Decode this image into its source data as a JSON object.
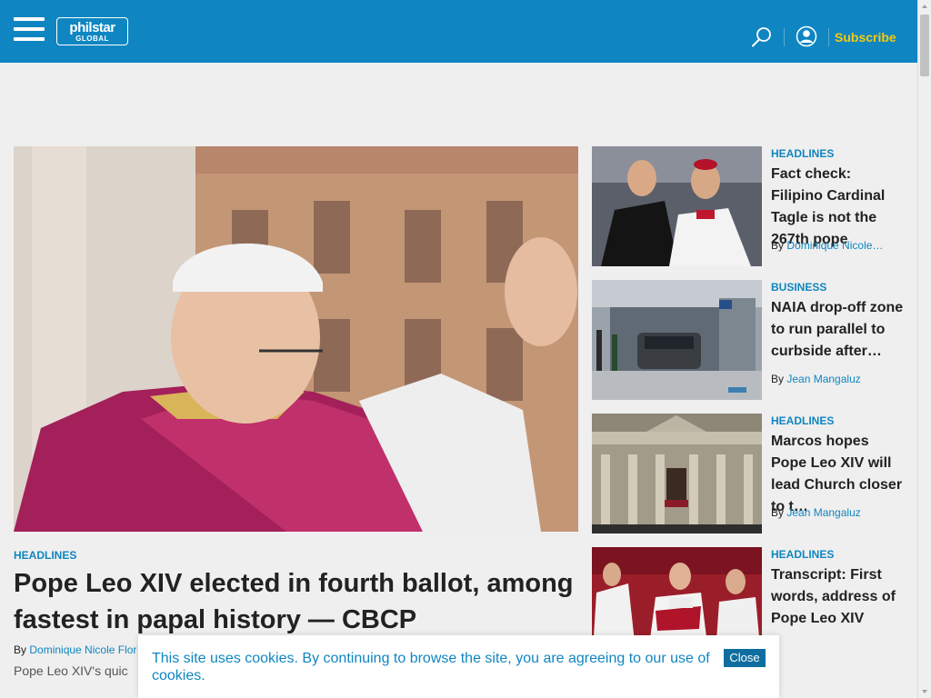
{
  "header": {
    "logo_top": "philstar",
    "logo_bottom": "GLOBAL",
    "subscribe_label": "Subscribe",
    "bg_color": "#0f86c1",
    "accent_color": "#f7c910"
  },
  "hero": {
    "category": "HEADLINES",
    "title": "Pope Leo XIV elected in fourth ballot, among fastest in papal history — CBCP",
    "by": "By",
    "author": "Dominique Nicole Flor",
    "summary": "Pope Leo XIV's quic"
  },
  "sidebar": {
    "items": [
      {
        "category": "HEADLINES",
        "title": "Fact check: Filipino Cardinal Tagle is not the 267th pope",
        "by": "By",
        "author": "Dominique Nicole…"
      },
      {
        "category": "BUSINESS",
        "title": "NAIA drop-off zone to run parallel to curbside after…",
        "by": "By",
        "author": "Jean Mangaluz"
      },
      {
        "category": "HEADLINES",
        "title": "Marcos hopes Pope Leo XIV will lead Church closer to t…",
        "by": "By",
        "author": "Jean Mangaluz"
      },
      {
        "category": "HEADLINES",
        "title": "Transcript: First words, address of Pope Leo XIV",
        "by": "",
        "author": ""
      }
    ]
  },
  "cookie": {
    "text": "This site uses cookies. By continuing to browse the site, you are agreeing to our use of cookies.",
    "close_label": "Close"
  }
}
